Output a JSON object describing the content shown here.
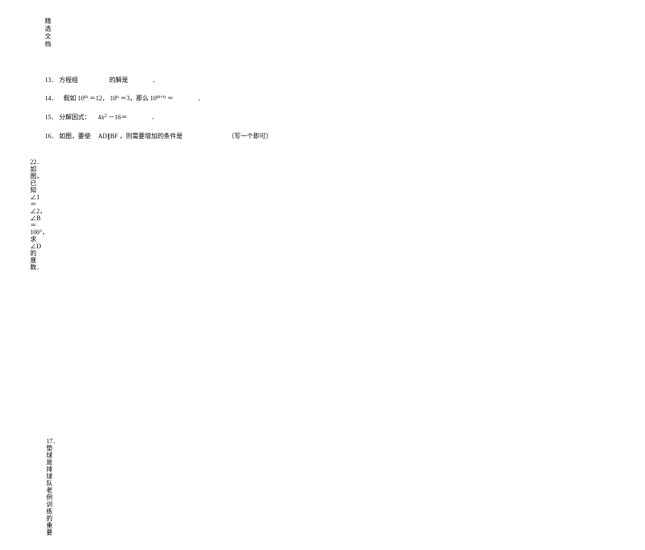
{
  "header": {
    "title": "精选文档"
  },
  "questions": {
    "q13": {
      "num": "13．",
      "t1": "方程组",
      "t2": "的解是",
      "t3": "．"
    },
    "q14": {
      "num": "14．",
      "t1": "假如",
      "e1": "10",
      "sup1": "m",
      "t2": "＝12，",
      "e2": "10",
      "sup2": "n",
      "t3": "＝3，那么",
      "e3": "10",
      "sup3": "m+n",
      "t4": "＝",
      "t5": "．"
    },
    "q15": {
      "num": "15．",
      "t1": "分解因式：",
      "e1": "4x",
      "sup1": "2",
      "t2": "－16＝",
      "t3": "．"
    },
    "q16": {
      "num": "16．",
      "t1": "如图，要使",
      "t2": "AD∥BF",
      "t3": "，则需要增加的条件是",
      "t4": "（写一个即可）"
    }
  },
  "vertical22": {
    "text": "22．如图，已知∠1＝∠2，∠B＝100°，求∠D的度数．"
  },
  "vertical17": {
    "text": "17．垫球是排球队老例训练的重要"
  }
}
